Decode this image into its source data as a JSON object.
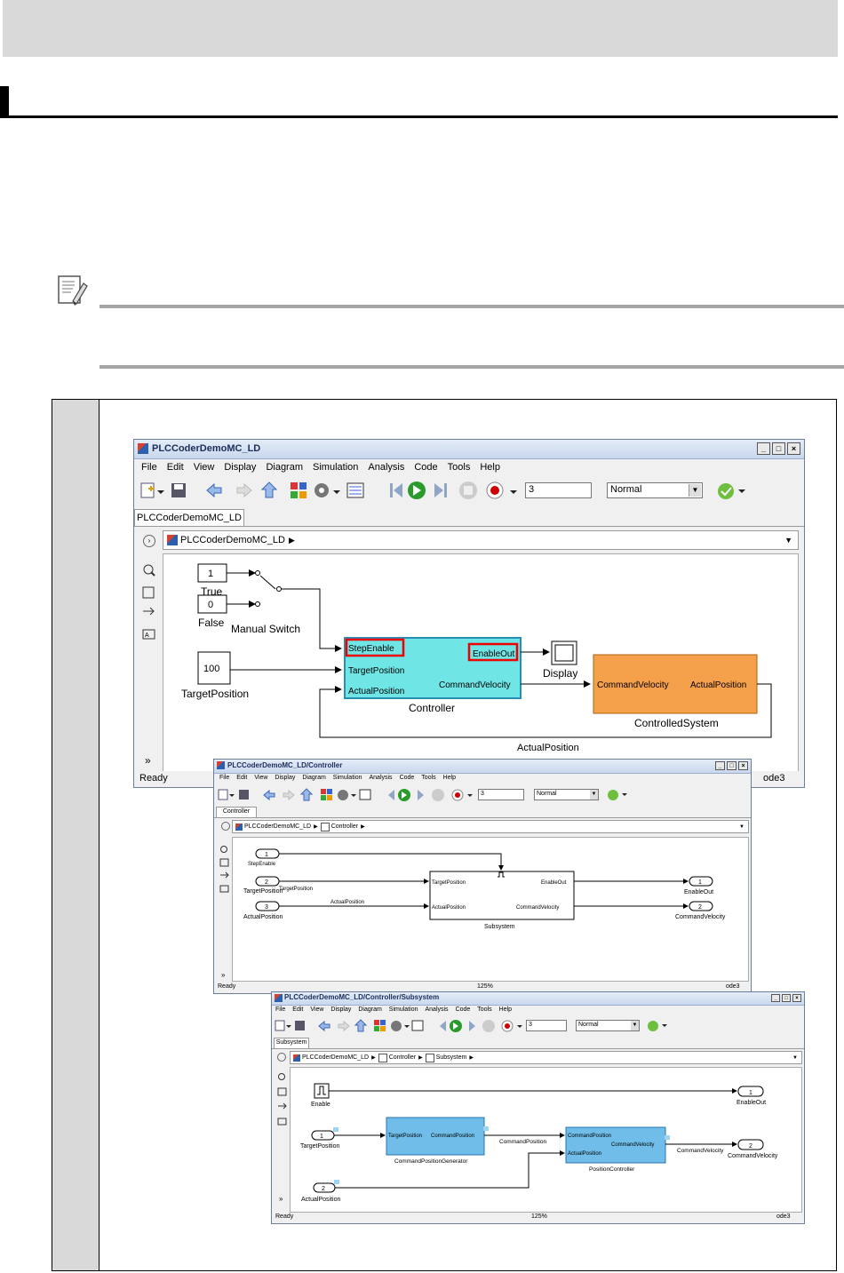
{
  "win1": {
    "title": "PLCCoderDemoMC_LD",
    "menu": [
      "File",
      "Edit",
      "View",
      "Display",
      "Diagram",
      "Simulation",
      "Analysis",
      "Code",
      "Tools",
      "Help"
    ],
    "stop_time": "3",
    "sim_mode": "Normal",
    "tab": "PLCCoderDemoMC_LD",
    "breadcrumb": [
      "PLCCoderDemoMC_LD"
    ],
    "status": "Ready",
    "solver": "ode3",
    "blocks": {
      "true_const": "1",
      "true_label": "True",
      "false_const": "0",
      "false_label": "False",
      "switch_label": "Manual Switch",
      "target_const": "100",
      "target_label": "TargetPosition",
      "controller_name": "Controller",
      "ctrl_in1": "StepEnable",
      "ctrl_in2": "TargetPosition",
      "ctrl_in3": "ActualPosition",
      "ctrl_out1": "EnableOut",
      "ctrl_out2": "CommandVelocity",
      "display_label": "Display",
      "sys_in": "CommandVelocity",
      "sys_out": "ActualPosition",
      "sys_name": "ControlledSystem",
      "feedback_label": "ActualPosition"
    }
  },
  "win2": {
    "title": "PLCCoderDemoMC_LD/Controller",
    "menu": [
      "File",
      "Edit",
      "View",
      "Display",
      "Diagram",
      "Simulation",
      "Analysis",
      "Code",
      "Tools",
      "Help"
    ],
    "stop_time": "3",
    "sim_mode": "Normal",
    "tab": "Controller",
    "breadcrumb": [
      "PLCCoderDemoMC_LD",
      "Controller"
    ],
    "status": "Ready",
    "zoom": "125%",
    "solver": "ode3",
    "blocks": {
      "in1_num": "1",
      "in1_label": "StepEnable",
      "in2_num": "2",
      "in2_label": "TargetPosition",
      "in3_num": "3",
      "in3_label": "ActualPosition",
      "sig2_label": "TargetPosition",
      "sig3_label": "ActualPosition",
      "sub_in1": "TargetPosition",
      "sub_in2": "ActualPosition",
      "sub_out1": "EnableOut",
      "sub_out2": "CommandVelocity",
      "sub_name": "Subsystem",
      "out1_num": "1",
      "out1_label": "EnableOut",
      "out2_num": "2",
      "out2_label": "CommandVelocity"
    }
  },
  "win3": {
    "title": "PLCCoderDemoMC_LD/Controller/Subsystem",
    "menu": [
      "File",
      "Edit",
      "View",
      "Display",
      "Diagram",
      "Simulation",
      "Analysis",
      "Code",
      "Tools",
      "Help"
    ],
    "stop_time": "3",
    "sim_mode": "Normal",
    "tab": "Subsystem",
    "breadcrumb": [
      "PLCCoderDemoMC_LD",
      "Controller",
      "Subsystem"
    ],
    "status": "Ready",
    "zoom": "125%",
    "solver": "ode3",
    "blocks": {
      "enable_label": "Enable",
      "in1_num": "1",
      "in1_label": "TargetPosition",
      "in2_num": "2",
      "in2_label": "ActualPosition",
      "cpg_in": "TargetPosition",
      "cpg_out": "CommandPosition",
      "cpg_name": "CommandPositionGenerator",
      "sig_label": "CommandPosition",
      "pc_in1": "CommandPosition",
      "pc_out": "CommandVelocity",
      "pc_in2": "ActualPosition",
      "pc_name": "PositionController",
      "sig2_label": "CommandVelocity",
      "out1_num": "1",
      "out1_label": "EnableOut",
      "out2_num": "2",
      "out2_label": "CommandVelocity"
    }
  }
}
